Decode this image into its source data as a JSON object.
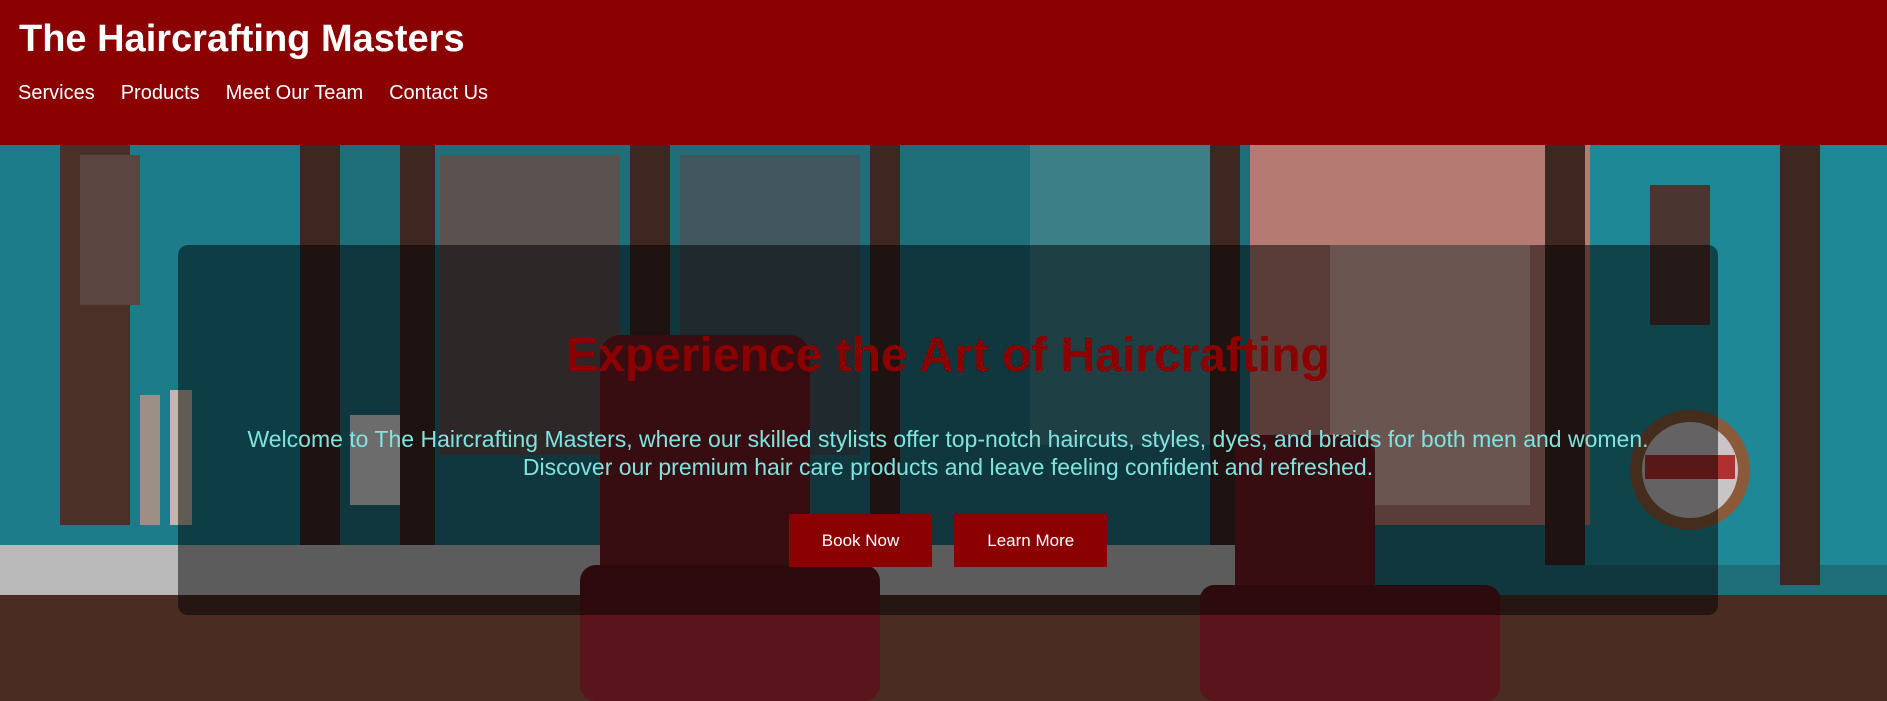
{
  "site": {
    "title": "The Haircrafting Masters"
  },
  "nav": {
    "items": [
      {
        "label": "Services"
      },
      {
        "label": "Products"
      },
      {
        "label": "Meet Our Team"
      },
      {
        "label": "Contact Us"
      }
    ]
  },
  "hero": {
    "title": "Experience the Art of Haircrafting",
    "text_line1": "Welcome to The Haircrafting Masters, where our skilled stylists offer top-notch haircuts, styles, dyes, and braids for both men and women.",
    "text_line2": "Discover our premium hair care products and leave feeling confident and refreshed.",
    "buttons": {
      "book": "Book Now",
      "learn": "Learn More"
    }
  },
  "colors": {
    "brand": "#8b0000",
    "accent_text": "#7fe3e0",
    "wall_teal": "#1f7f8c"
  }
}
